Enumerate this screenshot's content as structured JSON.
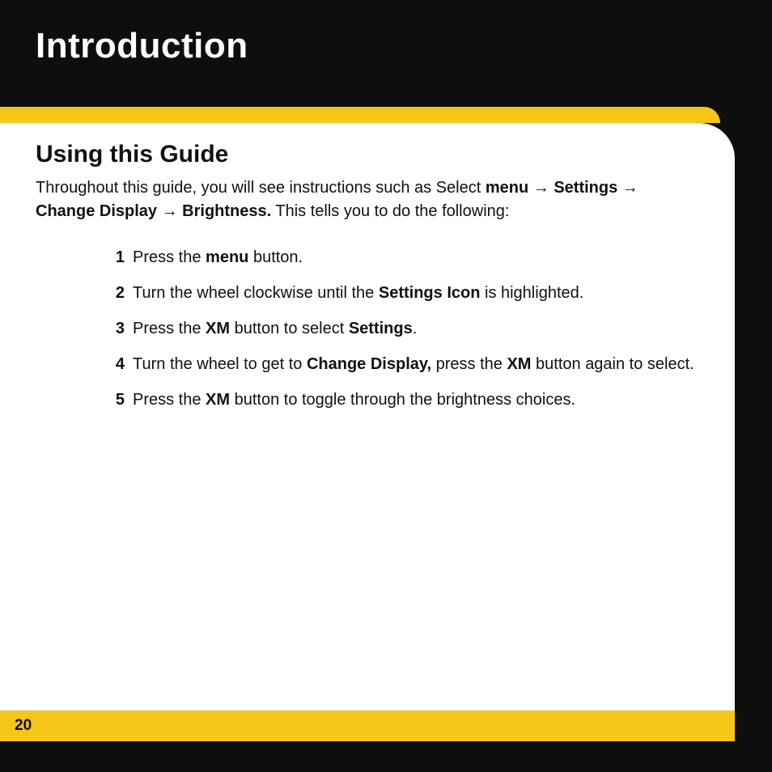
{
  "chapter": "Introduction",
  "section": "Using this Guide",
  "intro": {
    "pre": "Throughout this guide, you will see instructions such as Select ",
    "path1": "menu",
    "arrow": " → ",
    "path2": "Settings",
    "path3": "Change Display",
    "path4": "Brightness.",
    "post": " This tells you to do the following:"
  },
  "steps": [
    {
      "n": "1",
      "pre": "Press the ",
      "b1": "menu",
      "mid1": " button.",
      "b2": "",
      "mid2": "",
      "b3": "",
      "tail": ""
    },
    {
      "n": "2",
      "pre": "Turn the wheel clockwise until the ",
      "b1": "Settings Icon",
      "mid1": " is highlighted.",
      "b2": "",
      "mid2": "",
      "b3": "",
      "tail": ""
    },
    {
      "n": "3",
      "pre": "Press the ",
      "b1": "XM",
      "mid1": " button to select ",
      "b2": "Settings",
      "mid2": ".",
      "b3": "",
      "tail": ""
    },
    {
      "n": "4",
      "pre": "Turn the wheel to get to ",
      "b1": "Change Display,",
      "mid1": " press the ",
      "b2": "XM",
      "mid2": " button again to select.",
      "b3": "",
      "tail": ""
    },
    {
      "n": "5",
      "pre": "Press the ",
      "b1": "XM",
      "mid1": " button to toggle through the brightness choices.",
      "b2": "",
      "mid2": "",
      "b3": "",
      "tail": ""
    }
  ],
  "pageNumber": "20"
}
